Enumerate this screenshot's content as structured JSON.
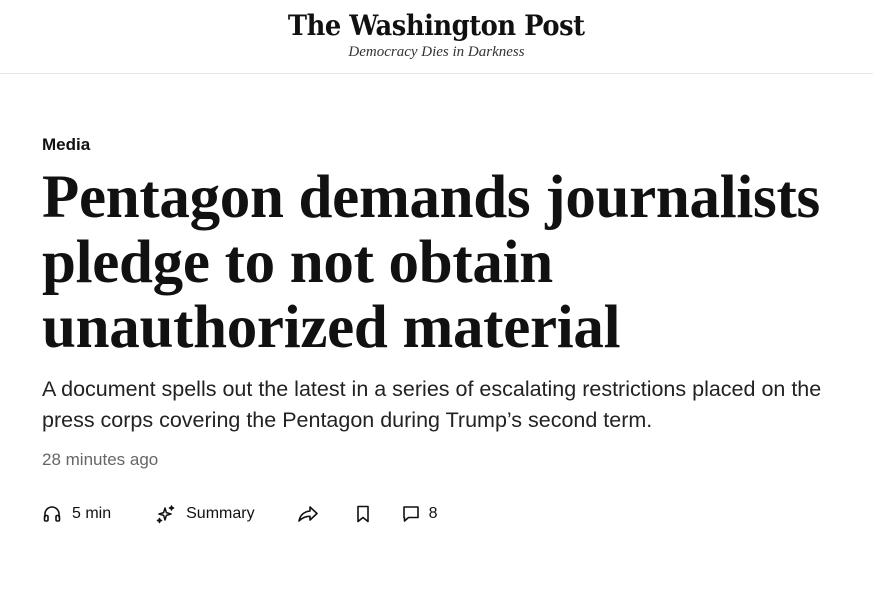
{
  "masthead": {
    "logo": "The Washington Post",
    "tagline": "Democracy Dies in Darkness"
  },
  "article": {
    "section": "Media",
    "headline": "Pentagon demands journalists pledge to not obtain unauthorized material",
    "dek": "A document spells out the latest in a series of escalating restrictions placed on the press corps covering the Pentagon during Trump’s second term.",
    "timestamp": "28 minutes ago"
  },
  "actions": {
    "listen": {
      "icon": "headphones-icon",
      "label": "5 min"
    },
    "summary": {
      "icon": "sparkle-icon",
      "label": "Summary"
    },
    "share": {
      "icon": "share-icon"
    },
    "save": {
      "icon": "bookmark-icon"
    },
    "comments": {
      "icon": "comment-icon",
      "count": "8"
    }
  }
}
